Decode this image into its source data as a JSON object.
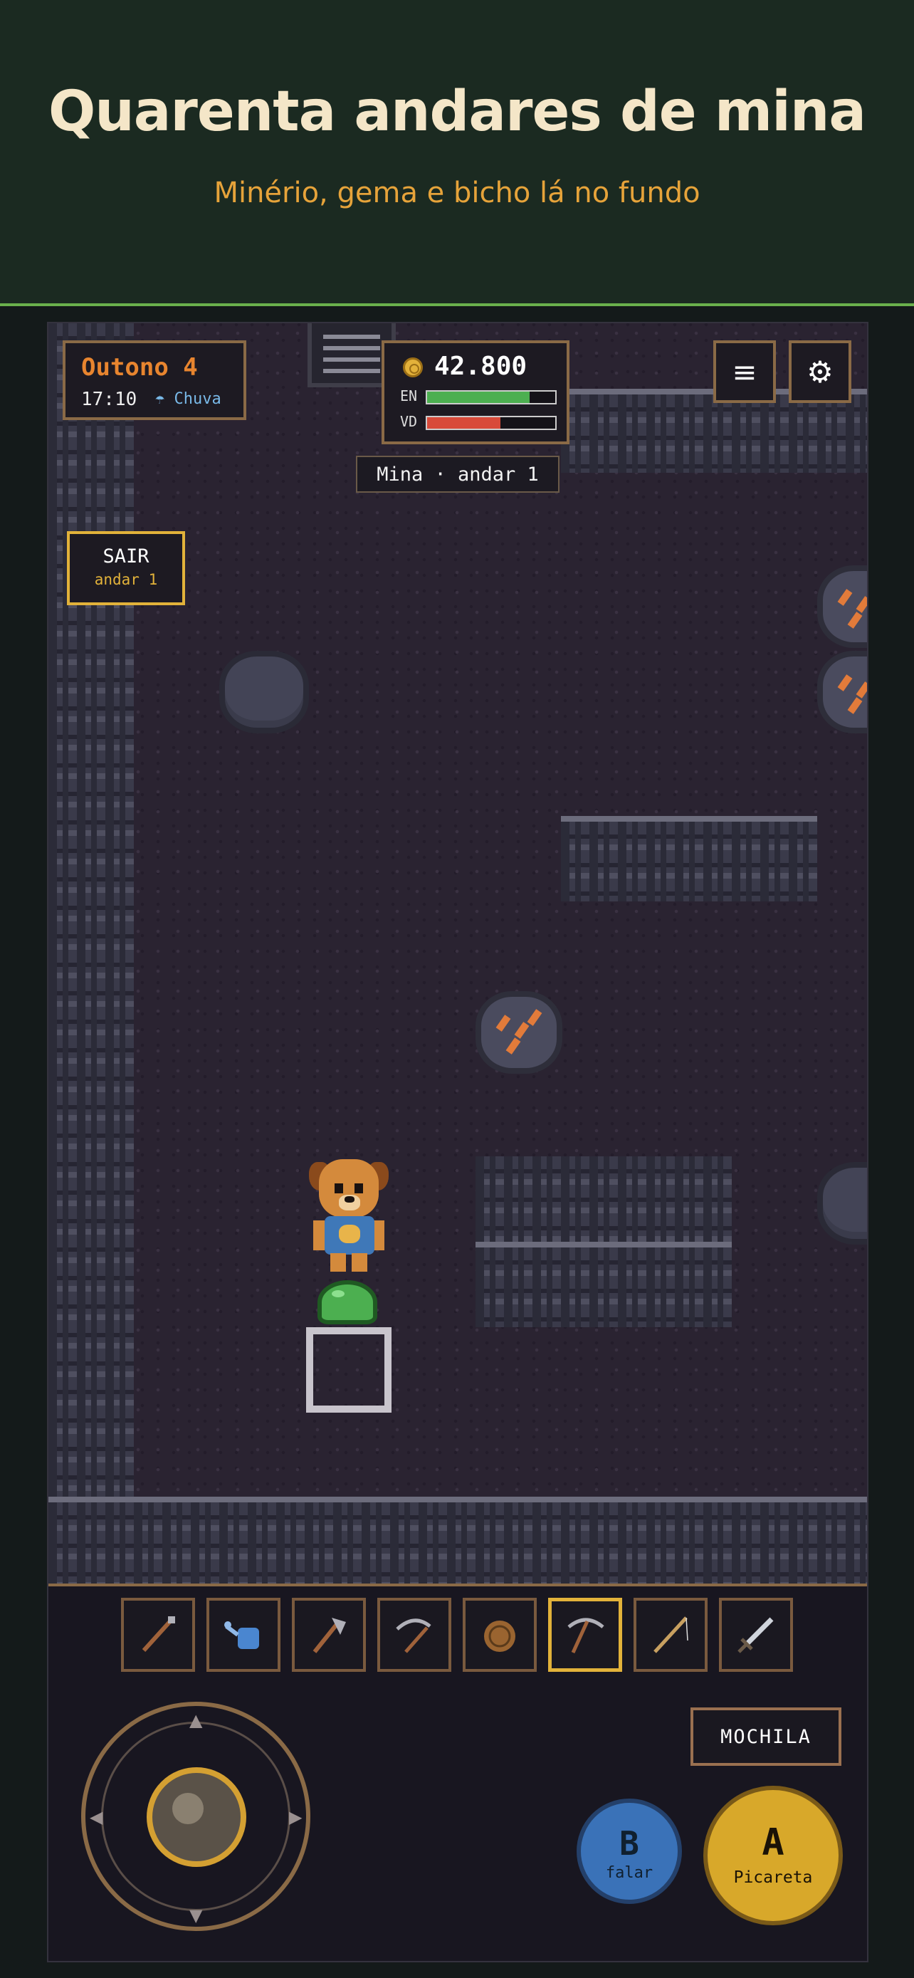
{
  "header": {
    "title": "Quarenta andares de mina",
    "subtitle": "Minério, gema e bicho lá no fundo"
  },
  "hud": {
    "season": "Outono 4",
    "time": "17:10",
    "weather_icon": "umbrella-icon",
    "weather_glyph": "☂",
    "weather": "Chuva",
    "money_icon": "coin-icon",
    "money": "42.800",
    "energy_label": "EN",
    "energy_fraction": 0.8,
    "health_label": "VD",
    "health_fraction": 0.57,
    "menu_icon": "≡",
    "settings_icon": "⚙",
    "floor_banner": "Mina · andar 1",
    "exit_label": "SAIR",
    "exit_sub": "andar 1"
  },
  "colors": {
    "accent_gold": "#e2b23a",
    "season_orange": "#e8852f",
    "energy": "#4caf50",
    "health": "#d84a3a",
    "button_b": "#3a72b8",
    "button_a": "#d8a82a"
  },
  "toolbar": {
    "selected_index": 5,
    "slots": [
      {
        "icon": "hoe-icon"
      },
      {
        "icon": "watering-can-icon"
      },
      {
        "icon": "axe-icon"
      },
      {
        "icon": "scythe-icon"
      },
      {
        "icon": "seed-bag-icon"
      },
      {
        "icon": "pickaxe-icon"
      },
      {
        "icon": "fishing-rod-icon"
      },
      {
        "icon": "sword-icon"
      }
    ]
  },
  "controls": {
    "bag_label": "MOCHILA",
    "b_label": "B",
    "b_sub": "falar",
    "a_label": "A",
    "a_sub": "Picareta",
    "arrow_up": "▲",
    "arrow_down": "▼",
    "arrow_left": "◀",
    "arrow_right": "▶"
  }
}
